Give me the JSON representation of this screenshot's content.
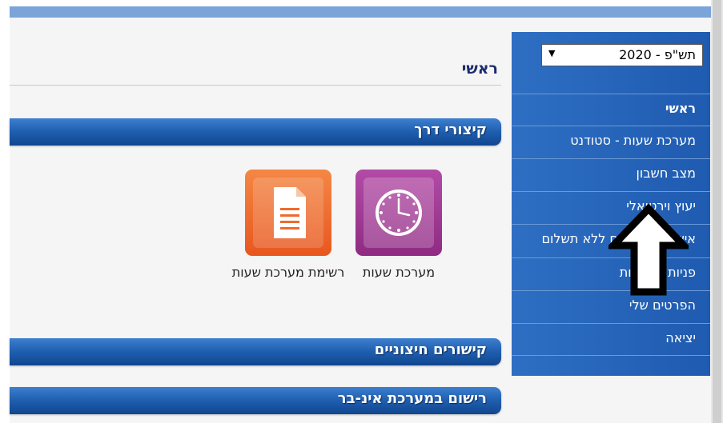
{
  "header": {
    "page_title": "ראשי"
  },
  "year_select": {
    "selected": "תש\"פ - 2020",
    "arrow_icon": "▼"
  },
  "sidebar": {
    "items": [
      {
        "label": "ראשי",
        "active": true
      },
      {
        "label": "מערכת שעות - סטודנט",
        "active": false
      },
      {
        "label": "מצב חשבון",
        "active": false
      },
      {
        "label": "יעוץ וירטואלי",
        "active": false
      },
      {
        "label": "אישורים וטפסים ללא תשלום",
        "active": false
      },
      {
        "label": "פניות מנהליות",
        "active": false
      },
      {
        "label": "הפרטים שלי",
        "active": false
      },
      {
        "label": "יציאה",
        "active": false
      }
    ]
  },
  "main": {
    "shortcuts_title": "קיצורי דרך",
    "shortcuts": [
      {
        "label": "מערכת שעות",
        "icon": "clock-icon",
        "color": "#9b3590"
      },
      {
        "label": "רשימת מערכת שעות",
        "icon": "document-icon",
        "color": "#ee6a2e"
      }
    ],
    "external_links_title": "קישורים חיצוניים",
    "inbar_registration_title": "רישום במערכת אינ-בר"
  },
  "overlay": {
    "icon": "up-arrow-annotation-icon",
    "color": "#000000"
  },
  "colors": {
    "sidebar": "#2563b8",
    "section_bar": "#1f5eae",
    "title": "#1e2b6e",
    "background": "#f5f5f5"
  }
}
